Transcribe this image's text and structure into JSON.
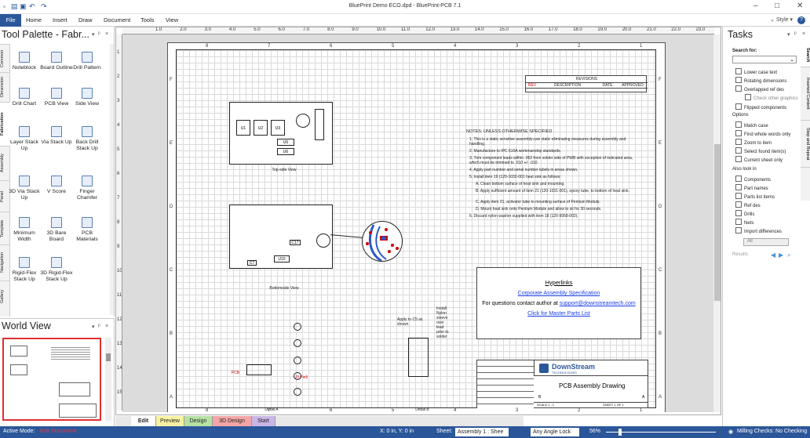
{
  "window": {
    "title": "BluePrint Demo ECO.dpd - BluePrint-PCB 7.1",
    "style_label": "Style"
  },
  "menu": {
    "file": "File",
    "items": [
      "Home",
      "Insert",
      "Draw",
      "Document",
      "Tools",
      "View"
    ]
  },
  "tool_palette": {
    "title": "Tool Palette - Fabr...",
    "vertical_tabs": [
      "Common",
      "Dimension",
      "Fabrication",
      "Assembly",
      "Panel",
      "Template",
      "Navigation",
      "Gallery"
    ],
    "tools": [
      {
        "label": "Noteblock",
        "icon": "noteblock-icon"
      },
      {
        "label": "Board Outline",
        "icon": "board-outline-icon"
      },
      {
        "label": "Drill Pattern",
        "icon": "drill-pattern-icon"
      },
      {
        "label": "Drill Chart",
        "icon": "drill-chart-icon"
      },
      {
        "label": "PCB View",
        "icon": "pcb-view-icon"
      },
      {
        "label": "Side View",
        "icon": "side-view-icon"
      },
      {
        "label": "Layer Stack Up",
        "icon": "layer-stackup-icon"
      },
      {
        "label": "Via Stack Up",
        "icon": "via-stackup-icon"
      },
      {
        "label": "Back Drill Stack Up",
        "icon": "back-drill-icon"
      },
      {
        "label": "3D Via Stack Up",
        "icon": "3d-via-icon"
      },
      {
        "label": "V Score",
        "icon": "v-score-icon"
      },
      {
        "label": "Finger Chamfer",
        "icon": "finger-chamfer-icon"
      },
      {
        "label": "Minimum Width",
        "icon": "minimum-width-icon"
      },
      {
        "label": "3D Bare Board",
        "icon": "3d-bare-board-icon"
      },
      {
        "label": "PCB Materials",
        "icon": "pcb-materials-icon"
      },
      {
        "label": "Rigid-Flex Stack Up",
        "icon": "rigid-flex-icon"
      },
      {
        "label": "3D Rigid-Flex Stack Up",
        "icon": "3d-rigid-flex-icon"
      }
    ]
  },
  "world_view": {
    "title": "World View"
  },
  "rulers": {
    "top": [
      "1.0",
      "2.0",
      "3.0",
      "4.0",
      "5.0",
      "6.0",
      "7.0",
      "8.0",
      "9.0",
      "10.0",
      "11.0",
      "12.0",
      "13.0",
      "14.0",
      "15.0",
      "16.0",
      "17.0",
      "18.0",
      "19.0",
      "20.0",
      "21.0",
      "22.0",
      "23.0"
    ],
    "left": [
      "1",
      "2",
      "3",
      "4",
      "5",
      "6",
      "7",
      "8",
      "9",
      "10",
      "11",
      "12",
      "13",
      "14",
      "15"
    ]
  },
  "drawing": {
    "zone_cols": [
      "8",
      "7",
      "6",
      "5",
      "4",
      "3",
      "2",
      "1"
    ],
    "zone_rows": [
      "F",
      "E",
      "D",
      "C",
      "B",
      "A"
    ],
    "revisions": {
      "title": "REVISIONS",
      "cols": [
        "REV",
        "DESCRIPTION",
        "DATE",
        "APPROVED"
      ]
    },
    "notes_title": "NOTES: UNLESS OTHERWISE SPECIFIED",
    "notes": [
      "1.  This is a static sensitive assembly-use static eliminating measures during assembly and handling.",
      "2.  Manufacture to IPC 610A workmanship standards.",
      "3.  Trim component leads within .062 from solder side of PWB with exception of indicated area, which must be trimmed to .010 +/- .010",
      "4.  Apply part number and serial number labels in areas shown.",
      "5.  Install item 19 (120-1032-001 heat sink as follows:",
      "A.  Clean bottom surface of heat sink and mounting.",
      "B.  Apply sufficient amount of item 21 (120-1031-001), epoxy tube, to bottom of heat sink.",
      "C.  Apply item 21, activator tube to mounting surface of Pentium Module.",
      "D.  Mount heat sink onto Pentium Module and allow to sit for 30 seconds.",
      "6.  Discard nylon washer supplied with item 18 (120-9958-002)."
    ],
    "top_view_caption": "Top-side View",
    "bottom_view_caption": "Bottomside View",
    "detail_a": "Detail A",
    "detail_b": "Detail B",
    "apply_note": "Apply to C5 as shown",
    "install_note": "Install Nylon sleeve over lead prior to solder",
    "components": [
      "U1",
      "U2",
      "U3",
      "U5",
      "U6",
      "U10",
      "C7",
      "C17"
    ],
    "pcb_label": "PCB",
    "j3_label": "J3 Pin5",
    "hyperlinks": {
      "title": "Hyperlinks",
      "spec": "Corporate Assembly Specification",
      "contact_prefix": "For questions contact author at ",
      "email": "support@downstreamtech.com",
      "parts": "Click for Master Parts List"
    },
    "title_block": {
      "company": "DownStream",
      "company_sub": "TECHNOLOGIES",
      "title": "PCB Assembly Drawing",
      "scale": "SCALE 1 : 1",
      "sheet": "SHEET 1 OF 1",
      "size": "B",
      "rev": "A"
    }
  },
  "sheet_tabs": [
    "Edit",
    "Preview",
    "Design",
    "3D Design",
    "Start"
  ],
  "tasks": {
    "title": "Tasks",
    "vertical_tabs": [
      "Search",
      "Inserted Content",
      "Step and Repeat"
    ],
    "search_for": "Search for:",
    "options_a": [
      "Lower case text",
      "Rotating dimensions",
      "Overlapped ref des"
    ],
    "check_other": "Check other graphics",
    "flipped": "Flipped components",
    "options_label": "Options",
    "options_b": [
      "Match case",
      "Find whole words only",
      "Zoom to item",
      "Select found item(s)",
      "Current sheet only"
    ],
    "also_look": "Also look in",
    "options_c": [
      "Components",
      "Part names",
      "Parts list items",
      "Ref des",
      "Drills",
      "Nets",
      "Import differences"
    ],
    "scope": "All",
    "results": "Results"
  },
  "status": {
    "active_mode_label": "Active Mode:",
    "active_mode": "Edit Document",
    "coords": "X: 0 in, Y: 0 in",
    "sheet_label": "Sheet:",
    "sheet_value": "Assembly 1 : Shee",
    "angle": "Any Angle Lock",
    "zoom": "56%",
    "milling": "Milling Checks: No Checking"
  }
}
